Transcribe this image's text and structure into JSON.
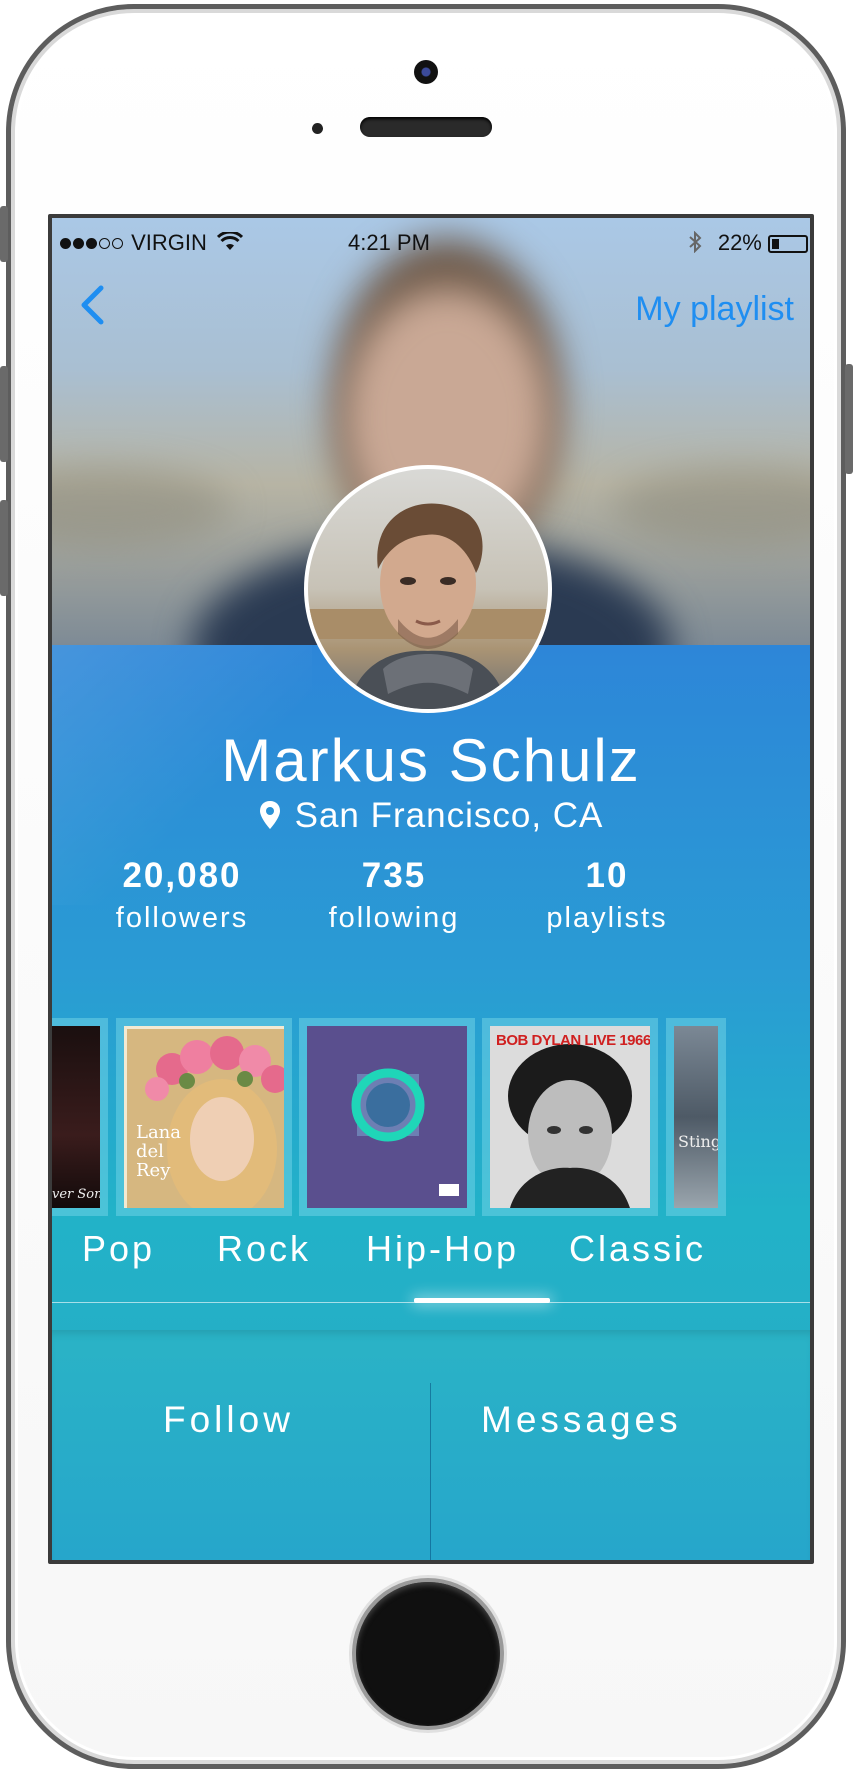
{
  "status_bar": {
    "carrier": "VIRGIN",
    "time": "4:21 PM",
    "battery": "22%",
    "battery_level": 0.22,
    "signal_bars_filled": 3,
    "signal_bars_total": 5,
    "icons": [
      "wifi-icon",
      "bluetooth-icon",
      "battery-icon"
    ]
  },
  "nav": {
    "back_icon": "chevron-left-icon",
    "right_link": "My playlist"
  },
  "profile": {
    "name": "Markus Schulz",
    "location_icon": "location-pin-icon",
    "location": "San Francisco, CA"
  },
  "stats": [
    {
      "value": "20,080",
      "label": "followers"
    },
    {
      "value": "735",
      "label": "following"
    },
    {
      "value": "10",
      "label": "playlists"
    }
  ],
  "albums": [
    {
      "caption": "ver Songs"
    },
    {
      "caption": "Lana del Rey"
    },
    {
      "caption": ""
    },
    {
      "caption": "BOB DYLAN LIVE 1966"
    },
    {
      "caption": "Sting"
    }
  ],
  "genres": {
    "tabs": [
      "Pop",
      "Rock",
      "Hip-Hop",
      "Classic"
    ],
    "selected": "Hip-Hop"
  },
  "actions": {
    "follow": "Follow",
    "messages": "Messages"
  },
  "colors": {
    "accent": "#1f8ef1",
    "panel_top": "#2d86d8",
    "panel_bottom": "#25aec6"
  }
}
